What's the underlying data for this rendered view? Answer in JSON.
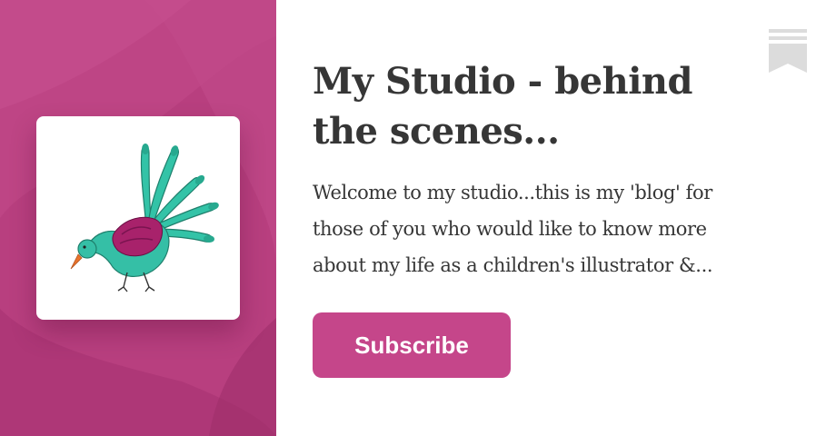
{
  "publication": {
    "title_lines": [
      "My Studio - behind",
      "the scenes..."
    ],
    "description_lines": [
      "Welcome to my studio...this is my 'blog' for",
      "those of you who would like to know more",
      "about my life as a children's illustrator &..."
    ]
  },
  "actions": {
    "subscribe_label": "Subscribe"
  },
  "icons": {
    "logo": "bird-illustration-logo",
    "bookmark": "bookmark-icon"
  },
  "colors": {
    "accent": "#c5468a",
    "panel": "#b83f7f",
    "text": "#363636",
    "bookmark": "#dcdcdc"
  }
}
